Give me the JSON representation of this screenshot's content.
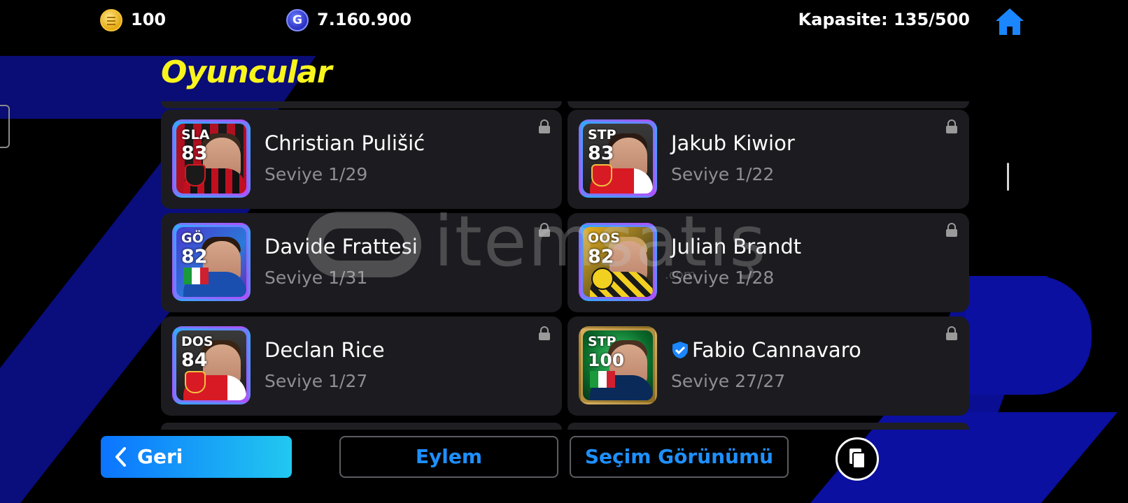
{
  "topbar": {
    "coins": "100",
    "gp": "7.160.900",
    "gp_icon_glyph": "G",
    "capacity": "Kapasite: 135/500"
  },
  "section_title": "Oyuncular",
  "players": [
    {
      "name": "Christian Pulišić",
      "level": "Seviye 1/29",
      "position": "SLA",
      "rating": "83",
      "verified": false
    },
    {
      "name": "Jakub Kiwior",
      "level": "Seviye 1/22",
      "position": "STP",
      "rating": "83",
      "verified": false
    },
    {
      "name": "Davide Frattesi",
      "level": "Seviye 1/31",
      "position": "GÖ",
      "rating": "82",
      "verified": false
    },
    {
      "name": "Julian Brandt",
      "level": "Seviye 1/28",
      "position": "OOS",
      "rating": "82",
      "verified": false
    },
    {
      "name": "Declan Rice",
      "level": "Seviye 1/27",
      "position": "DOS",
      "rating": "84",
      "verified": false
    },
    {
      "name": "Fabio Cannavaro",
      "level": "Seviye 27/27",
      "position": "STP",
      "rating": "100",
      "verified": true
    }
  ],
  "watermark": {
    "text": "itemsatış",
    "sub": ".com"
  },
  "bottombar": {
    "back_label": "Geri",
    "action_label": "Eylem",
    "view_label": "Seçim Görünümü"
  },
  "colors": {
    "title_yellow": "#f9f51c",
    "accent_blue": "#1e90ff",
    "card_bg": "#1c1c20"
  }
}
